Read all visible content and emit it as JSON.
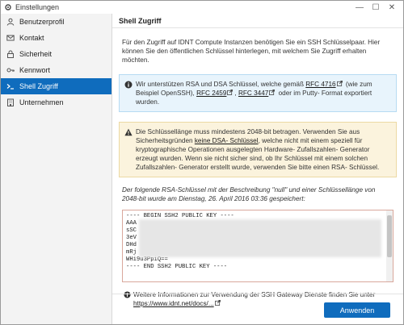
{
  "window": {
    "title": "Einstellungen",
    "minimize": "—",
    "maximize": "☐",
    "close": "✕"
  },
  "sidebar": {
    "items": [
      {
        "label": "Benutzerprofil",
        "icon": "user-icon"
      },
      {
        "label": "Kontakt",
        "icon": "envelope-icon"
      },
      {
        "label": "Sicherheit",
        "icon": "lock-icon"
      },
      {
        "label": "Kennwort",
        "icon": "key-icon"
      },
      {
        "label": "Shell Zugriff",
        "icon": "terminal-icon",
        "active": true
      },
      {
        "label": "Unternehmen",
        "icon": "building-icon"
      }
    ]
  },
  "main": {
    "header": "Shell Zugriff",
    "intro": "Für den Zugriff auf IDNT Compute Instanzen benötigen Sie ein SSH Schlüsselpaar. Hier können Sie den öffentlichen Schlüssel hinterlegen, mit welchem Sie Zugriff erhalten möchten.",
    "info": {
      "text1": "Wir unterstützen RSA und DSA Schlüssel, welche gemäß ",
      "rfc4716": "RFC 4716",
      "text2": " (wie zum Beispiel OpenSSH), ",
      "rfc2459": "RFC 2459",
      "text3": ", ",
      "rfc3447": "RFC 3447",
      "text4": " oder im Putty- Format exportiert wurden."
    },
    "warning": {
      "text1": "Die Schlüssellänge muss mindestens 2048-bit betragen. Verwenden Sie aus Sicherheitsgründen ",
      "link": "keine DSA- Schlüssel",
      "text2": ", welche nicht mit einem speziell für kryptographische Operationen ausgelegten Hardware- Zufallszahlen- Generator erzeugt wurden. Wenn sie nicht sicher sind, ob Ihr Schlüssel mit einem solchen Zufallszahlen- Generator erstellt wurde, verwenden Sie bitte einen RSA- Schlüssel."
    },
    "key_description": "Der folgende RSA-Schlüssel mit der Beschreibung \"null\" und einer Schlüssellänge von 2048-bit wurde am Dienstag, 26. April 2016 03:36 gespeichert:",
    "key_lines": [
      "---- BEGIN SSH2 PUBLIC KEY ----",
      "AAA",
      "sSC",
      "3eV",
      "DHd",
      "mRj",
      "WHi9u3PpiQ==",
      "---- END SSH2 PUBLIC KEY ----"
    ],
    "more_info": {
      "text": "Weitere Informationen zur Verwendung der SSH Gateway Dienste finden Sie unter ",
      "link": "https://www.idnt.net/docs/..."
    },
    "apply_label": "Anwenden"
  },
  "colors": {
    "accent": "#0f6cbd",
    "info_bg": "#e8f4fc",
    "warn_bg": "#fbf3dd"
  }
}
